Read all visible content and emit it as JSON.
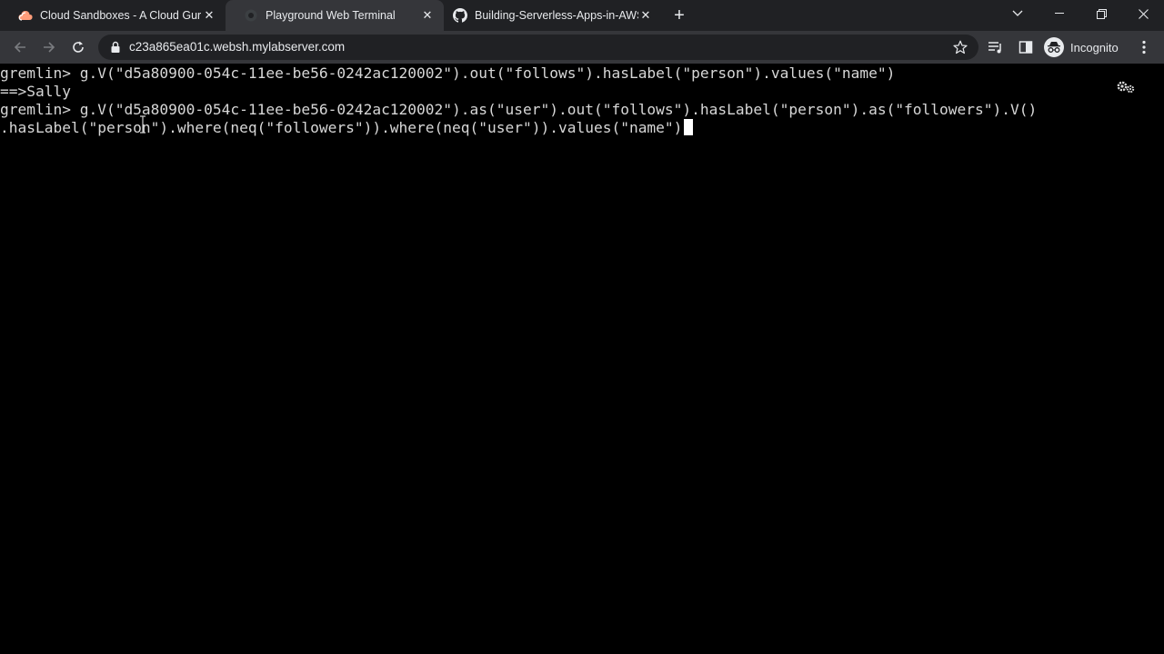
{
  "browser": {
    "tabs": [
      {
        "title": "Cloud Sandboxes - A Cloud Guru",
        "icon": "acloudguru-cloud-icon",
        "active": false
      },
      {
        "title": "Playground Web Terminal",
        "icon": "terminal-globe-icon",
        "active": true
      },
      {
        "title": "Building-Serverless-Apps-in-AWS",
        "icon": "github-icon",
        "active": false
      }
    ],
    "new_tab_label": "+",
    "url": "c23a865ea01c.websh.mylabserver.com",
    "profile_label": "Incognito"
  },
  "terminal": {
    "lines": [
      "gremlin> g.V(\"d5a80900-054c-11ee-be56-0242ac120002\").out(\"follows\").hasLabel(\"person\").values(\"name\")",
      "==>Sally",
      "gremlin> g.V(\"d5a80900-054c-11ee-be56-0242ac120002\").as(\"user\").out(\"follows\").hasLabel(\"person\").as(\"followers\").V()",
      ".hasLabel(\"person\").where(neq(\"followers\")).where(neq(\"user\")).values(\"name\")"
    ]
  },
  "colors": {
    "tab_strip": "#202124",
    "toolbar": "#35363a",
    "terminal_bg": "#000000",
    "terminal_fg": "#d7d7d7"
  }
}
